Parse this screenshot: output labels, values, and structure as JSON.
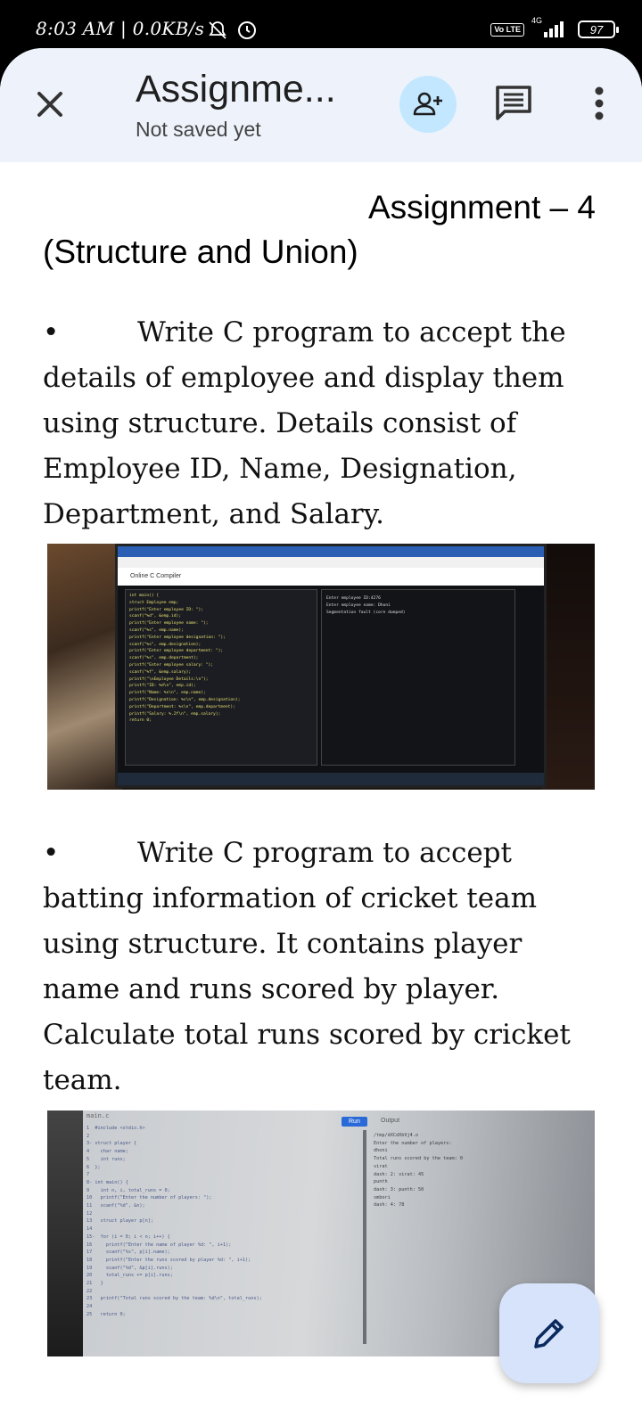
{
  "status_bar": {
    "time": "8:03 AM",
    "speed": "0.0KB/s",
    "volte": "Vo LTE",
    "network": "4G",
    "battery": "97"
  },
  "app_bar": {
    "title": "Assignme...",
    "subtitle": "Not saved yet",
    "close_icon": "close-icon",
    "share_icon": "person-add-icon",
    "comment_icon": "comment-icon",
    "more_icon": "more-vert-icon"
  },
  "document": {
    "heading_line1": "Assignment – 4",
    "heading_line2": "(Structure and Union)",
    "bullet": "•",
    "question1": "Write C program to accept the details of employee and display them using structure. Details consist of Employee ID, Name, Designation, Department, and Salary.",
    "question2": "Write C program to accept batting information of cricket team using structure. It contains player name and runs scored by player. Calculate total runs scored by cricket team.",
    "photo1": {
      "tab_title": "Online C Compiler",
      "code_lines": [
        "int main() {",
        "struct Employee emp;",
        "printf(\"Enter employee ID: \");",
        "scanf(\"%d\", &emp.id);",
        "printf(\"Enter employee name: \");",
        "scanf(\"%s\", emp.name);",
        "printf(\"Enter employee designation: \");",
        "scanf(\"%s\", emp.designation);",
        "printf(\"Enter employee department: \");",
        "scanf(\"%s\", emp.department);",
        "printf(\"Enter employee salary: \");",
        "scanf(\"%f\", &emp.salary);",
        "printf(\"\\nEmployee Details:\\n\");",
        "printf(\"ID: %d\\n\", emp.id);",
        "printf(\"Name: %s\\n\", emp.name);",
        "printf(\"Designation: %s\\n\", emp.designation);",
        "printf(\"Department: %s\\n\", emp.department);",
        "printf(\"Salary: %.2f\\n\", emp.salary);",
        "return 0;"
      ],
      "output_lines": [
        "Enter employee ID:4276",
        "Enter employee name: Dhoni",
        "Segmentation fault (core dumped)"
      ]
    },
    "photo2": {
      "file_name": "main.c",
      "run_label": "Run",
      "output_label": "Output",
      "code_lines": [
        "1  #include <stdio.h>",
        "2",
        "3- struct player {",
        "4    char name;",
        "5    int runs;",
        "6  };",
        "7",
        "8- int main() {",
        "9    int n, i, total_runs = 0;",
        "10   printf(\"Enter the number of players: \");",
        "11   scanf(\"%d\", &n);",
        "12",
        "13   struct player p[n];",
        "14",
        "15-  for (i = 0; i < n; i++) {",
        "16     printf(\"Enter the name of player %d: \", i+1);",
        "17     scanf(\"%s\", p[i].name);",
        "18     printf(\"Enter the runs scored by player %d: \", i+1);",
        "19     scanf(\"%d\", &p[i].runs);",
        "20     total_runs += p[i].runs;",
        "21   }",
        "22",
        "23   printf(\"Total runs scored by the team: %d\\n\", total_runs);",
        "24",
        "25   return 0;"
      ],
      "output_lines": [
        "/tmp/dXCdXbVj4.o",
        "Enter the number of players:",
        "dhoni",
        "Total runs scored by the team: 0",
        "virat",
        "dash: 2: virat: 45",
        "punth",
        "dash: 3: punth: 50",
        "smbori",
        "dash: 4: 78"
      ]
    }
  },
  "fab": {
    "icon": "edit-pencil-icon"
  }
}
